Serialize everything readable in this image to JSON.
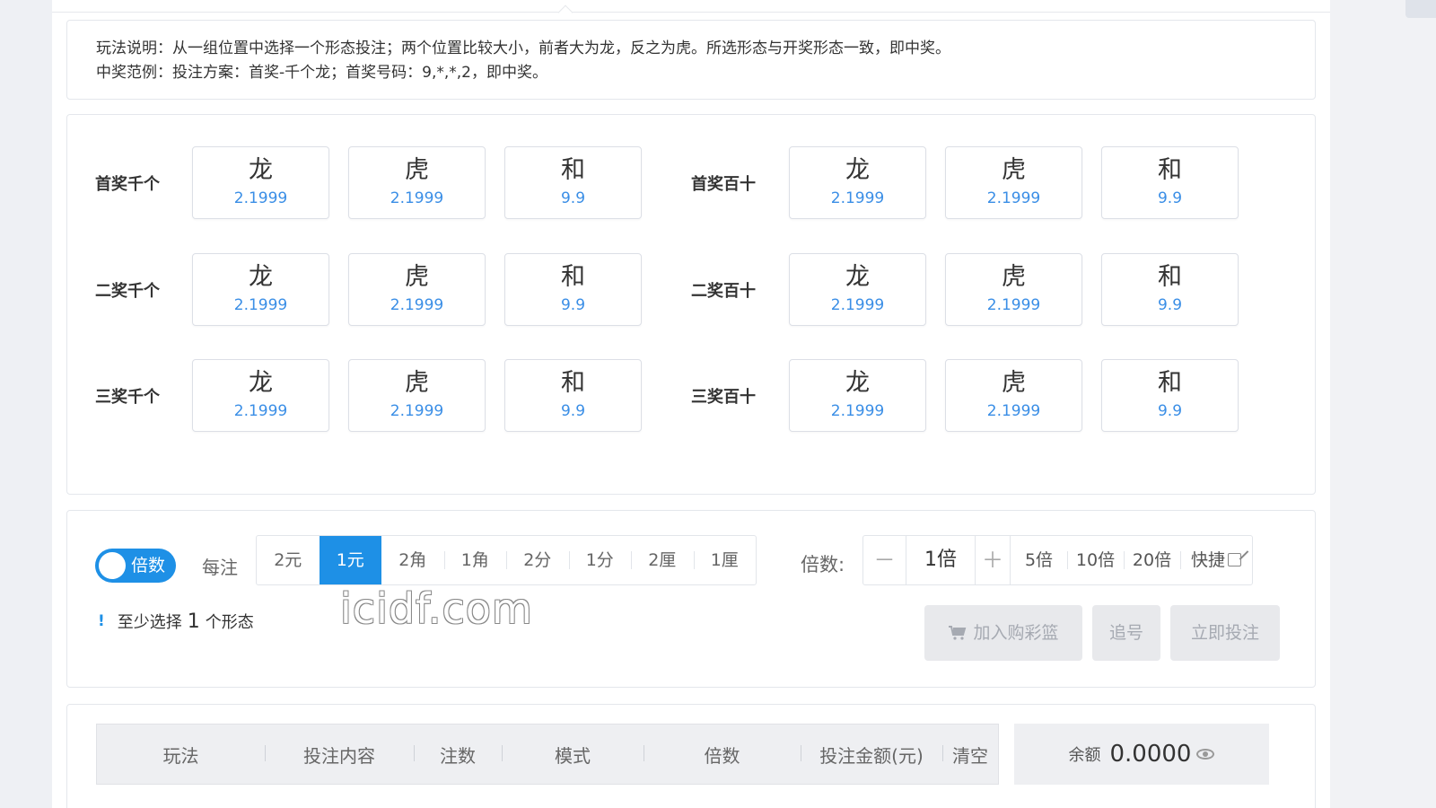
{
  "rules": {
    "line1": "玩法说明：从一组位置中选择一个形态投注；两个位置比较大小，前者大为龙，反之为虎。所选形态与开奖形态一致，即中奖。",
    "line2": "中奖范例：投注方案：首奖-千个龙；首奖号码：9,*,*,2，即中奖。"
  },
  "bet_rows": [
    {
      "label": "首奖千个",
      "options": [
        {
          "name": "龙",
          "odds": "2.1999"
        },
        {
          "name": "虎",
          "odds": "2.1999"
        },
        {
          "name": "和",
          "odds": "9.9"
        }
      ]
    },
    {
      "label": "首奖百十",
      "options": [
        {
          "name": "龙",
          "odds": "2.1999"
        },
        {
          "name": "虎",
          "odds": "2.1999"
        },
        {
          "name": "和",
          "odds": "9.9"
        }
      ]
    },
    {
      "label": "二奖千个",
      "options": [
        {
          "name": "龙",
          "odds": "2.1999"
        },
        {
          "name": "虎",
          "odds": "2.1999"
        },
        {
          "name": "和",
          "odds": "9.9"
        }
      ]
    },
    {
      "label": "二奖百十",
      "options": [
        {
          "name": "龙",
          "odds": "2.1999"
        },
        {
          "name": "虎",
          "odds": "2.1999"
        },
        {
          "name": "和",
          "odds": "9.9"
        }
      ]
    },
    {
      "label": "三奖千个",
      "options": [
        {
          "name": "龙",
          "odds": "2.1999"
        },
        {
          "name": "虎",
          "odds": "2.1999"
        },
        {
          "name": "和",
          "odds": "9.9"
        }
      ]
    },
    {
      "label": "三奖百十",
      "options": [
        {
          "name": "龙",
          "odds": "2.1999"
        },
        {
          "name": "虎",
          "odds": "2.1999"
        },
        {
          "name": "和",
          "odds": "9.9"
        }
      ]
    }
  ],
  "controls": {
    "toggle_label": "倍数",
    "per_bet_label": "每注",
    "units": [
      "2元",
      "1元",
      "2角",
      "1角",
      "2分",
      "1分",
      "2厘",
      "1厘"
    ],
    "selected_unit": "1元",
    "multiplier_label": "倍数:",
    "minus": "－",
    "multiplier_value": "1倍",
    "plus": "＋",
    "presets": [
      "5倍",
      "10倍",
      "20倍"
    ],
    "quick_label": "快捷",
    "hint_icon": "!",
    "hint_prefix": "至少选择",
    "hint_count": "1",
    "hint_suffix": "个形态",
    "add_cart": "加入购彩篮",
    "chase": "追号",
    "bet_now": "立即投注"
  },
  "watermark": "icidf.com",
  "cart": {
    "columns": [
      "玩法",
      "投注内容",
      "注数",
      "模式",
      "倍数",
      "投注金额(元)",
      "清空"
    ],
    "balance_label": "余额",
    "balance_value": "0.0000"
  },
  "colors": {
    "accent": "#1e90e6",
    "odds": "#3a8ee6"
  },
  "icons": {
    "cart": "cart-icon",
    "quick": "edit-icon",
    "balance": "eye-icon",
    "hint": "info-icon"
  }
}
